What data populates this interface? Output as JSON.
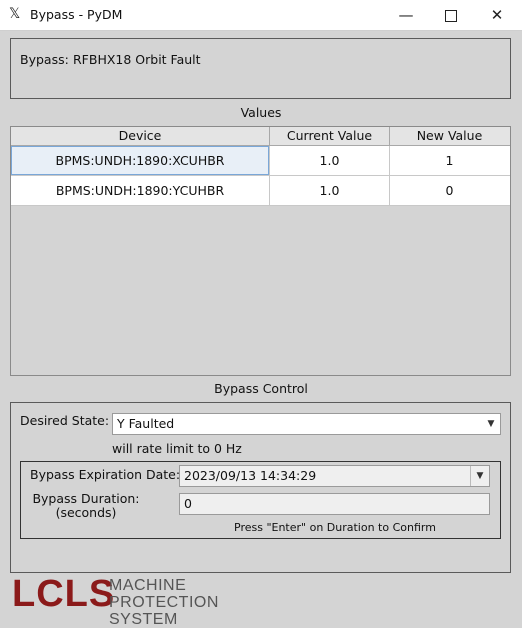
{
  "window": {
    "title": "Bypass - PyDM",
    "app_icon": "x-logo-icon",
    "minimize_glyph": "—",
    "close_glyph": "✕"
  },
  "bypass": {
    "label": "Bypass:",
    "value": "RFBHX18 Orbit Fault"
  },
  "values": {
    "title": "Values",
    "columns": [
      "Device",
      "Current Value",
      "New Value"
    ],
    "rows": [
      {
        "device": "BPMS:UNDH:1890:XCUHBR",
        "current": "1.0",
        "new": "1"
      },
      {
        "device": "BPMS:UNDH:1890:YCUHBR",
        "current": "1.0",
        "new": "0"
      }
    ]
  },
  "control": {
    "title": "Bypass Control",
    "desired_label": "Desired State:",
    "desired_value": "Y Faulted",
    "rate_limit_text": "will rate limit to 0 Hz",
    "expiration_label": "Bypass Expiration Date:",
    "expiration_value": "2023/09/13 14:34:29",
    "duration_label_line1": "Bypass Duration:",
    "duration_label_line2": "(seconds)",
    "duration_value": "0",
    "confirm_hint": "Press \"Enter\" on Duration to Confirm"
  },
  "footer": {
    "logo_text": "LCLS",
    "logo_sub_line1": "MACHINE",
    "logo_sub_line2": "PROTECTION SYSTEM"
  },
  "colors": {
    "logo": "#8b1a1a",
    "background": "#d4d4d4"
  }
}
